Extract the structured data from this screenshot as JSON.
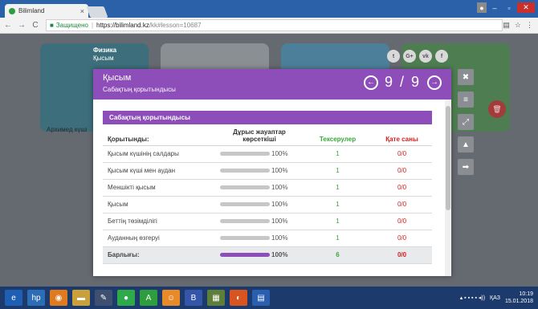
{
  "browser": {
    "tab_title": "Bilimland",
    "tab_close": "×",
    "secure_label": "Защищено",
    "url_host": "https://bilimland.kz",
    "url_path": "/kk#lesson=10687"
  },
  "background": {
    "course_title": "Физика",
    "course_sub": "Қысым",
    "card_caption": "Архимед күші",
    "social": [
      "t",
      "G+",
      "vk",
      "f"
    ]
  },
  "modal": {
    "title": "Қысым",
    "subtitle": "Сабақтың қорытындысы",
    "page_current": 9,
    "page_total": 9,
    "summary_heading": "Сабақтың қорытындысы",
    "columns": {
      "topic": "Қорытынды:",
      "correct": "Дұрыс жауаптар көрсеткіші",
      "tests": "Тексерулер",
      "errors": "Қате саны"
    },
    "rows": [
      {
        "topic": "Қысым күшінің салдары",
        "percent": "100%",
        "fill": 1.0,
        "tests": "1",
        "errors": "0/0"
      },
      {
        "topic": "Қысым күші мен аудан",
        "percent": "100%",
        "fill": 1.0,
        "tests": "1",
        "errors": "0/0"
      },
      {
        "topic": "Меншікті қысым",
        "percent": "100%",
        "fill": 1.0,
        "tests": "1",
        "errors": "0/0"
      },
      {
        "topic": "Қысым",
        "percent": "100%",
        "fill": 1.0,
        "tests": "1",
        "errors": "0/0"
      },
      {
        "topic": "Беттің төзімділігі",
        "percent": "100%",
        "fill": 1.0,
        "tests": "1",
        "errors": "0/0"
      },
      {
        "topic": "Ауданның өзгеруі",
        "percent": "100%",
        "fill": 1.0,
        "tests": "1",
        "errors": "0/0"
      }
    ],
    "total": {
      "topic": "Барлығы:",
      "percent": "100%",
      "fill": 1.0,
      "tests": "6",
      "errors": "0/0"
    }
  },
  "taskbar": {
    "language": "ҚАЗ",
    "time": "10:19",
    "date": "15.01.2018"
  },
  "colors": {
    "accent": "#8e4eba",
    "pass": "#3aa63a",
    "error": "#d32020"
  }
}
